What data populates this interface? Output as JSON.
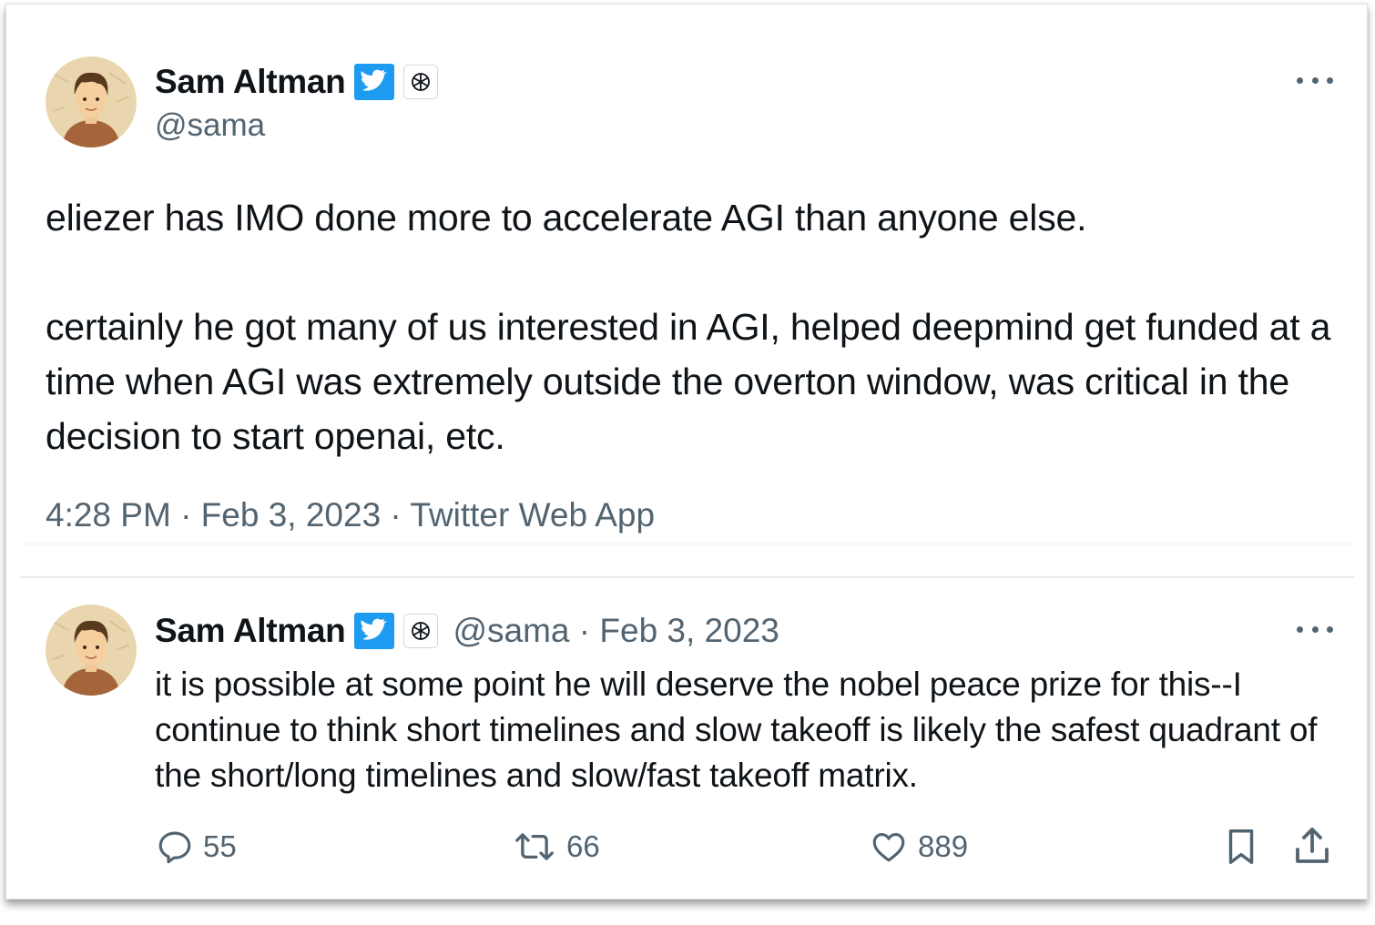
{
  "main_tweet": {
    "author": {
      "display_name": "Sam Altman",
      "handle": "@sama",
      "verified_icon": "twitter-verified-badge",
      "affiliate_icon": "openai-logo"
    },
    "text_paragraphs": [
      "eliezer has IMO done more to accelerate AGI than anyone else.",
      "certainly he got many of us interested in AGI, helped deepmind get funded at a time when AGI was extremely outside the overton window, was critical in the decision to start openai, etc."
    ],
    "timestamp": "4:28 PM · Feb 3, 2023 · Twitter Web App"
  },
  "reply_tweet": {
    "author": {
      "display_name": "Sam Altman",
      "handle_and_date": "@sama · Feb 3, 2023"
    },
    "text": "it is possible at some point he will deserve the nobel peace prize for this--I continue to think short timelines and slow takeoff is likely the safest quadrant of the short/long timelines and slow/fast takeoff matrix.",
    "actions": {
      "replies": "55",
      "retweets": "66",
      "likes": "889"
    }
  },
  "colors": {
    "text_primary": "#0f1419",
    "text_secondary": "#536471",
    "verified_blue": "#1d9bf0",
    "divider": "#eff3f4"
  }
}
